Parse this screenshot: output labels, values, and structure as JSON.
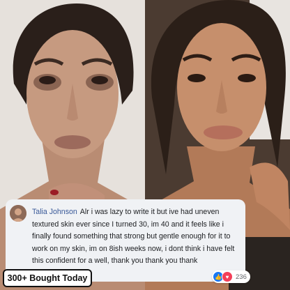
{
  "images": {
    "before_photo": "before-photo-woman-face",
    "after_photo": "after-photo-woman-face"
  },
  "review": {
    "reviewer_name": "Talia Johnson",
    "comment": "Alr i was lazy to write it but ive had uneven textured skin ever since I turned 30, im 40 and it feels like i finally found something that strong but gentle enough for it to work on my skin, im on 8ish weeks now, i dont think i have felt this confident for a well, thank you thank you thank",
    "reaction_count": "236",
    "reactions": [
      "like-icon",
      "love-icon"
    ]
  },
  "badge": {
    "label": "300+ Bought Today"
  },
  "colors": {
    "name_link": "#385898",
    "like": "#1877f2",
    "love": "#f33e58",
    "review_bg": "#f0f2f5"
  }
}
